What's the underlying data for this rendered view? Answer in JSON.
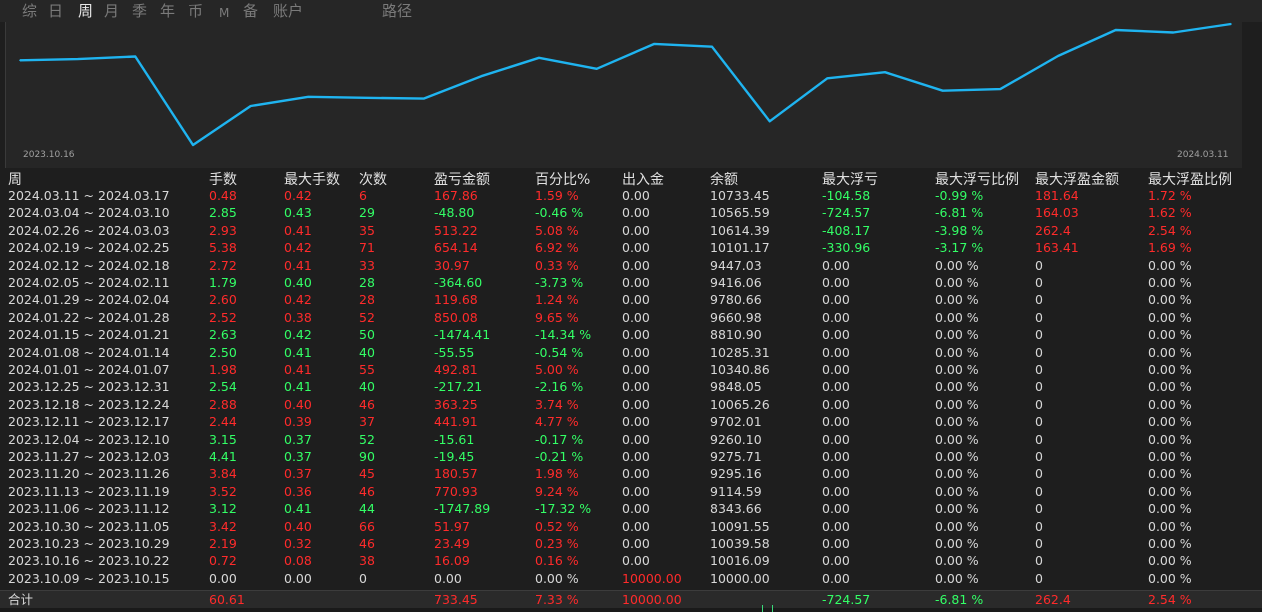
{
  "tabs": [
    {
      "label": "综",
      "active": false
    },
    {
      "label": "日",
      "active": false
    },
    {
      "label": "周",
      "active": true
    },
    {
      "label": "月",
      "active": false
    },
    {
      "label": "季",
      "active": false
    },
    {
      "label": "年",
      "active": false
    },
    {
      "label": "币",
      "active": false
    },
    {
      "label": "M",
      "active": false
    },
    {
      "label": "备",
      "active": false
    },
    {
      "label": "账户",
      "active": false
    },
    {
      "label": "路径",
      "active": false
    }
  ],
  "chart_data": {
    "type": "line",
    "x_start_label": "2023.10.16",
    "x_end_label": "2024.03.11",
    "series": [
      {
        "values": [
          10016.09,
          10039.58,
          10091.55,
          8343.66,
          9114.59,
          9295.16,
          9275.71,
          9260.1,
          9702.01,
          10065.26,
          9848.05,
          10340.86,
          10285.31,
          8810.9,
          9660.98,
          9780.66,
          9416.06,
          9447.03,
          10101.17,
          10614.39,
          10565.59,
          10733.45
        ]
      }
    ],
    "ylim": [
      8343.66,
      10733.45
    ],
    "color": "#1fb4f0",
    "grid": false
  },
  "columns": [
    "周",
    "手数",
    "最大手数",
    "次数",
    "盈亏金额",
    "百分比%",
    "出入金",
    "余额",
    "最大浮亏",
    "最大浮亏比例",
    "最大浮盈金额",
    "最大浮盈比例"
  ],
  "rows": [
    {
      "week": "2024.03.11 ~ 2024.03.17",
      "lots": "0.48",
      "max_lots": "0.42",
      "count": "6",
      "pnl": "167.86",
      "pct": "1.59 %",
      "flow": "0.00",
      "balance": "10733.45",
      "max_loss": "-104.58",
      "max_loss_pct": "-0.99 %",
      "max_profit": "181.64",
      "max_profit_pct": "1.72 %",
      "dir": "up",
      "loss_active": true,
      "profit_active": true
    },
    {
      "week": "2024.03.04 ~ 2024.03.10",
      "lots": "2.85",
      "max_lots": "0.43",
      "count": "29",
      "pnl": "-48.80",
      "pct": "-0.46 %",
      "flow": "0.00",
      "balance": "10565.59",
      "max_loss": "-724.57",
      "max_loss_pct": "-6.81 %",
      "max_profit": "164.03",
      "max_profit_pct": "1.62 %",
      "dir": "down",
      "loss_active": true,
      "profit_active": true
    },
    {
      "week": "2024.02.26 ~ 2024.03.03",
      "lots": "2.93",
      "max_lots": "0.41",
      "count": "35",
      "pnl": "513.22",
      "pct": "5.08 %",
      "flow": "0.00",
      "balance": "10614.39",
      "max_loss": "-408.17",
      "max_loss_pct": "-3.98 %",
      "max_profit": "262.4",
      "max_profit_pct": "2.54 %",
      "dir": "up",
      "loss_active": true,
      "profit_active": true
    },
    {
      "week": "2024.02.19 ~ 2024.02.25",
      "lots": "5.38",
      "max_lots": "0.42",
      "count": "71",
      "pnl": "654.14",
      "pct": "6.92 %",
      "flow": "0.00",
      "balance": "10101.17",
      "max_loss": "-330.96",
      "max_loss_pct": "-3.17 %",
      "max_profit": "163.41",
      "max_profit_pct": "1.69 %",
      "dir": "up",
      "loss_active": true,
      "profit_active": true
    },
    {
      "week": "2024.02.12 ~ 2024.02.18",
      "lots": "2.72",
      "max_lots": "0.41",
      "count": "33",
      "pnl": "30.97",
      "pct": "0.33 %",
      "flow": "0.00",
      "balance": "9447.03",
      "max_loss": "0.00",
      "max_loss_pct": "0.00 %",
      "max_profit": "0",
      "max_profit_pct": "0.00 %",
      "dir": "up",
      "loss_active": false,
      "profit_active": false
    },
    {
      "week": "2024.02.05 ~ 2024.02.11",
      "lots": "1.79",
      "max_lots": "0.40",
      "count": "28",
      "pnl": "-364.60",
      "pct": "-3.73 %",
      "flow": "0.00",
      "balance": "9416.06",
      "max_loss": "0.00",
      "max_loss_pct": "0.00 %",
      "max_profit": "0",
      "max_profit_pct": "0.00 %",
      "dir": "down",
      "loss_active": false,
      "profit_active": false
    },
    {
      "week": "2024.01.29 ~ 2024.02.04",
      "lots": "2.60",
      "max_lots": "0.42",
      "count": "28",
      "pnl": "119.68",
      "pct": "1.24 %",
      "flow": "0.00",
      "balance": "9780.66",
      "max_loss": "0.00",
      "max_loss_pct": "0.00 %",
      "max_profit": "0",
      "max_profit_pct": "0.00 %",
      "dir": "up",
      "loss_active": false,
      "profit_active": false
    },
    {
      "week": "2024.01.22 ~ 2024.01.28",
      "lots": "2.52",
      "max_lots": "0.38",
      "count": "52",
      "pnl": "850.08",
      "pct": "9.65 %",
      "flow": "0.00",
      "balance": "9660.98",
      "max_loss": "0.00",
      "max_loss_pct": "0.00 %",
      "max_profit": "0",
      "max_profit_pct": "0.00 %",
      "dir": "up",
      "loss_active": false,
      "profit_active": false
    },
    {
      "week": "2024.01.15 ~ 2024.01.21",
      "lots": "2.63",
      "max_lots": "0.42",
      "count": "50",
      "pnl": "-1474.41",
      "pct": "-14.34 %",
      "flow": "0.00",
      "balance": "8810.90",
      "max_loss": "0.00",
      "max_loss_pct": "0.00 %",
      "max_profit": "0",
      "max_profit_pct": "0.00 %",
      "dir": "down",
      "loss_active": false,
      "profit_active": false
    },
    {
      "week": "2024.01.08 ~ 2024.01.14",
      "lots": "2.50",
      "max_lots": "0.41",
      "count": "40",
      "pnl": "-55.55",
      "pct": "-0.54 %",
      "flow": "0.00",
      "balance": "10285.31",
      "max_loss": "0.00",
      "max_loss_pct": "0.00 %",
      "max_profit": "0",
      "max_profit_pct": "0.00 %",
      "dir": "down",
      "loss_active": false,
      "profit_active": false
    },
    {
      "week": "2024.01.01 ~ 2024.01.07",
      "lots": "1.98",
      "max_lots": "0.41",
      "count": "55",
      "pnl": "492.81",
      "pct": "5.00 %",
      "flow": "0.00",
      "balance": "10340.86",
      "max_loss": "0.00",
      "max_loss_pct": "0.00 %",
      "max_profit": "0",
      "max_profit_pct": "0.00 %",
      "dir": "up",
      "loss_active": false,
      "profit_active": false
    },
    {
      "week": "2023.12.25 ~ 2023.12.31",
      "lots": "2.54",
      "max_lots": "0.41",
      "count": "40",
      "pnl": "-217.21",
      "pct": "-2.16 %",
      "flow": "0.00",
      "balance": "9848.05",
      "max_loss": "0.00",
      "max_loss_pct": "0.00 %",
      "max_profit": "0",
      "max_profit_pct": "0.00 %",
      "dir": "down",
      "loss_active": false,
      "profit_active": false
    },
    {
      "week": "2023.12.18 ~ 2023.12.24",
      "lots": "2.88",
      "max_lots": "0.40",
      "count": "46",
      "pnl": "363.25",
      "pct": "3.74 %",
      "flow": "0.00",
      "balance": "10065.26",
      "max_loss": "0.00",
      "max_loss_pct": "0.00 %",
      "max_profit": "0",
      "max_profit_pct": "0.00 %",
      "dir": "up",
      "loss_active": false,
      "profit_active": false
    },
    {
      "week": "2023.12.11 ~ 2023.12.17",
      "lots": "2.44",
      "max_lots": "0.39",
      "count": "37",
      "pnl": "441.91",
      "pct": "4.77 %",
      "flow": "0.00",
      "balance": "9702.01",
      "max_loss": "0.00",
      "max_loss_pct": "0.00 %",
      "max_profit": "0",
      "max_profit_pct": "0.00 %",
      "dir": "up",
      "loss_active": false,
      "profit_active": false
    },
    {
      "week": "2023.12.04 ~ 2023.12.10",
      "lots": "3.15",
      "max_lots": "0.37",
      "count": "52",
      "pnl": "-15.61",
      "pct": "-0.17 %",
      "flow": "0.00",
      "balance": "9260.10",
      "max_loss": "0.00",
      "max_loss_pct": "0.00 %",
      "max_profit": "0",
      "max_profit_pct": "0.00 %",
      "dir": "down",
      "loss_active": false,
      "profit_active": false
    },
    {
      "week": "2023.11.27 ~ 2023.12.03",
      "lots": "4.41",
      "max_lots": "0.37",
      "count": "90",
      "pnl": "-19.45",
      "pct": "-0.21 %",
      "flow": "0.00",
      "balance": "9275.71",
      "max_loss": "0.00",
      "max_loss_pct": "0.00 %",
      "max_profit": "0",
      "max_profit_pct": "0.00 %",
      "dir": "down",
      "loss_active": false,
      "profit_active": false
    },
    {
      "week": "2023.11.20 ~ 2023.11.26",
      "lots": "3.84",
      "max_lots": "0.37",
      "count": "45",
      "pnl": "180.57",
      "pct": "1.98 %",
      "flow": "0.00",
      "balance": "9295.16",
      "max_loss": "0.00",
      "max_loss_pct": "0.00 %",
      "max_profit": "0",
      "max_profit_pct": "0.00 %",
      "dir": "up",
      "loss_active": false,
      "profit_active": false
    },
    {
      "week": "2023.11.13 ~ 2023.11.19",
      "lots": "3.52",
      "max_lots": "0.36",
      "count": "46",
      "pnl": "770.93",
      "pct": "9.24 %",
      "flow": "0.00",
      "balance": "9114.59",
      "max_loss": "0.00",
      "max_loss_pct": "0.00 %",
      "max_profit": "0",
      "max_profit_pct": "0.00 %",
      "dir": "up",
      "loss_active": false,
      "profit_active": false
    },
    {
      "week": "2023.11.06 ~ 2023.11.12",
      "lots": "3.12",
      "max_lots": "0.41",
      "count": "44",
      "pnl": "-1747.89",
      "pct": "-17.32 %",
      "flow": "0.00",
      "balance": "8343.66",
      "max_loss": "0.00",
      "max_loss_pct": "0.00 %",
      "max_profit": "0",
      "max_profit_pct": "0.00 %",
      "dir": "down",
      "loss_active": false,
      "profit_active": false
    },
    {
      "week": "2023.10.30 ~ 2023.11.05",
      "lots": "3.42",
      "max_lots": "0.40",
      "count": "66",
      "pnl": "51.97",
      "pct": "0.52 %",
      "flow": "0.00",
      "balance": "10091.55",
      "max_loss": "0.00",
      "max_loss_pct": "0.00 %",
      "max_profit": "0",
      "max_profit_pct": "0.00 %",
      "dir": "up",
      "loss_active": false,
      "profit_active": false
    },
    {
      "week": "2023.10.23 ~ 2023.10.29",
      "lots": "2.19",
      "max_lots": "0.32",
      "count": "46",
      "pnl": "23.49",
      "pct": "0.23 %",
      "flow": "0.00",
      "balance": "10039.58",
      "max_loss": "0.00",
      "max_loss_pct": "0.00 %",
      "max_profit": "0",
      "max_profit_pct": "0.00 %",
      "dir": "up",
      "loss_active": false,
      "profit_active": false
    },
    {
      "week": "2023.10.16 ~ 2023.10.22",
      "lots": "0.72",
      "max_lots": "0.08",
      "count": "38",
      "pnl": "16.09",
      "pct": "0.16 %",
      "flow": "0.00",
      "balance": "10016.09",
      "max_loss": "0.00",
      "max_loss_pct": "0.00 %",
      "max_profit": "0",
      "max_profit_pct": "0.00 %",
      "dir": "up",
      "loss_active": false,
      "profit_active": false
    },
    {
      "week": "2023.10.09 ~ 2023.10.15",
      "lots": "0.00",
      "max_lots": "0.00",
      "count": "0",
      "pnl": "0.00",
      "pct": "0.00 %",
      "flow": "10000.00",
      "balance": "10000.00",
      "max_loss": "0.00",
      "max_loss_pct": "0.00 %",
      "max_profit": "0",
      "max_profit_pct": "0.00 %",
      "dir": "flat",
      "loss_active": false,
      "profit_active": false,
      "flow_active": true
    }
  ],
  "total": {
    "label": "合计",
    "lots": "60.61",
    "pnl": "733.45",
    "pct": "7.33 %",
    "flow": "10000.00",
    "max_loss": "-724.57",
    "max_loss_pct": "-6.81 %",
    "max_profit": "262.4",
    "max_profit_pct": "2.54 %"
  },
  "colors": {
    "red": "#ff2b2b",
    "green": "#33ff66",
    "line": "#1fb4f0"
  }
}
